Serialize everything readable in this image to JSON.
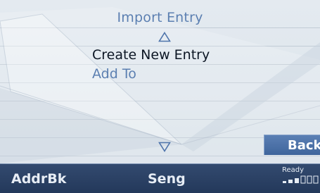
{
  "menu": {
    "import_label": "Import Entry",
    "create_label": "Create New Entry",
    "add_label": "Add To"
  },
  "icons": {
    "up": "triangle-up",
    "down": "triangle-down"
  },
  "back_label": "Back",
  "bottom_bar": {
    "left_label": "AddrBk",
    "center_label": "Seng",
    "status_text": "Ready",
    "signal_level": 0.5
  },
  "colors": {
    "accent": "#5b7fb1",
    "selected_text": "#0c1624",
    "bar": "#2a4064"
  }
}
